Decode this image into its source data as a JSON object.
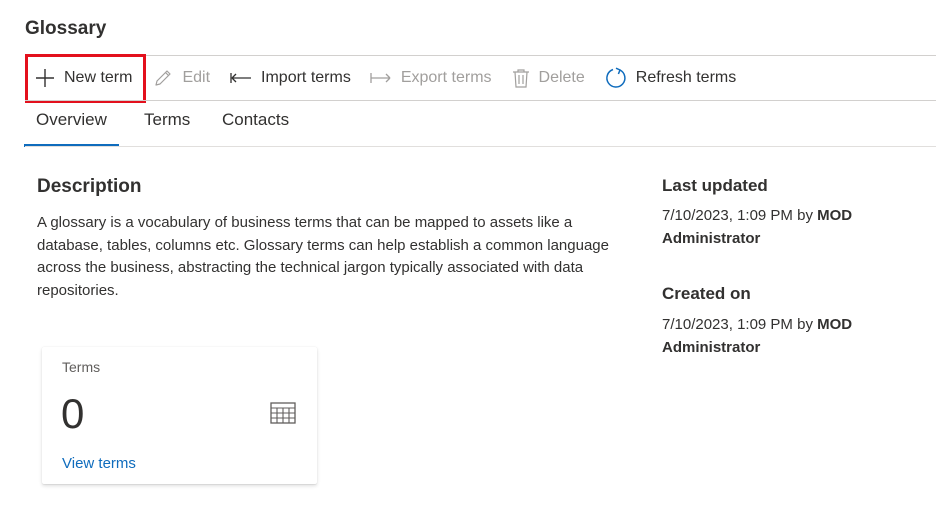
{
  "page": {
    "title": "Glossary"
  },
  "toolbar": {
    "new_term": {
      "label": "New term",
      "icon": "plus-icon",
      "enabled": true,
      "highlighted": true
    },
    "edit": {
      "label": "Edit",
      "icon": "pencil-icon",
      "enabled": false
    },
    "import_terms": {
      "label": "Import terms",
      "icon": "import-arrow-icon",
      "enabled": true
    },
    "export_terms": {
      "label": "Export terms",
      "icon": "export-arrow-icon",
      "enabled": false
    },
    "delete": {
      "label": "Delete",
      "icon": "trash-icon",
      "enabled": false
    },
    "refresh_terms": {
      "label": "Refresh terms",
      "icon": "refresh-icon",
      "enabled": true
    }
  },
  "tabs": {
    "items": [
      {
        "label": "Overview",
        "active": true
      },
      {
        "label": "Terms",
        "active": false
      },
      {
        "label": "Contacts",
        "active": false
      }
    ]
  },
  "description": {
    "heading": "Description",
    "text": "A glossary is a vocabulary of business terms that can be mapped to assets like a database, tables, columns etc. Glossary terms can help establish a common language across the business, abstracting the technical jargon typically associated with data repositories."
  },
  "meta": {
    "last_updated": {
      "label": "Last updated",
      "date": "7/10/2023, 1:09 PM by ",
      "user": "MOD Administrator"
    },
    "created_on": {
      "label": "Created on",
      "date": "7/10/2023, 1:09 PM by ",
      "user": "MOD Administrator"
    }
  },
  "terms_card": {
    "label": "Terms",
    "count": "0",
    "icon": "table-grid-icon",
    "link": "View terms"
  },
  "colors": {
    "accent": "#0f6cbd",
    "highlight_box": "#e3101d",
    "text": "#323130",
    "disabled": "#a19f9d"
  }
}
